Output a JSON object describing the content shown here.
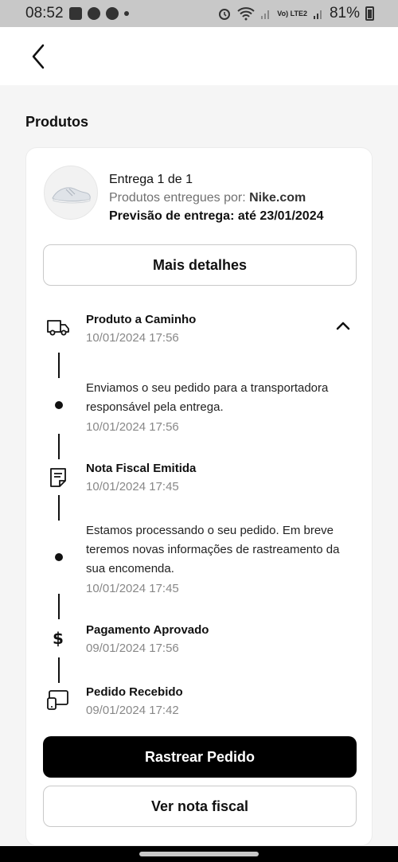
{
  "status_bar": {
    "time": "08:52",
    "battery": "81%",
    "network_label": "Vo) LTE2",
    "icons": [
      "gallery-icon",
      "whatsapp-icon",
      "cloud-icon",
      "alarm-icon",
      "wifi-icon",
      "signal-icon",
      "battery-icon"
    ]
  },
  "header": {
    "back_icon": "chevron-left-icon"
  },
  "section": {
    "title": "Produtos"
  },
  "delivery": {
    "title": "Entrega 1 de 1",
    "seller_prefix": "Produtos entregues por:",
    "seller": "Nike.com",
    "forecast": "Previsão de entrega: até 23/01/2024",
    "details_button": "Mais detalhes"
  },
  "timeline": [
    {
      "type": "status",
      "icon": "truck-icon",
      "title": "Produto a Caminho",
      "date": "10/01/2024 17:56"
    },
    {
      "type": "event",
      "description": "Enviamos o seu pedido para a transportadora responsável pela entrega.",
      "date": "10/01/2024 17:56"
    },
    {
      "type": "status",
      "icon": "invoice-icon",
      "title": "Nota Fiscal Emitida",
      "date": "10/01/2024 17:45"
    },
    {
      "type": "event",
      "description": "Estamos processando o seu pedido. Em breve teremos novas informações de rastreamento da sua encomenda.",
      "date": "10/01/2024 17:45"
    },
    {
      "type": "status",
      "icon": "dollar-icon",
      "title": "Pagamento Aprovado",
      "date": "09/01/2024 17:56"
    },
    {
      "type": "status",
      "icon": "devices-icon",
      "title": "Pedido Recebido",
      "date": "09/01/2024 17:42"
    }
  ],
  "actions": {
    "track": "Rastrear Pedido",
    "invoice": "Ver nota fiscal"
  },
  "colors": {
    "primary": "#000000",
    "muted_text": "#707070",
    "background": "#f5f5f5"
  }
}
